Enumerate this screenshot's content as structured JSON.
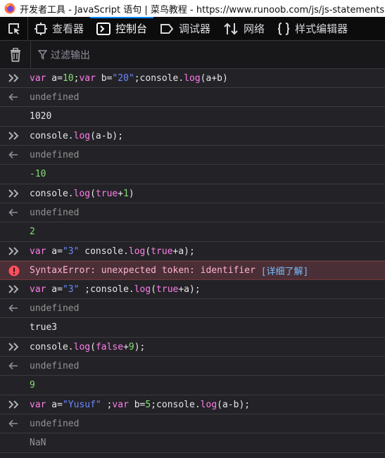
{
  "titlebar": {
    "text": "开发者工具 - JavaScript 语句 | 菜鸟教程 - https://www.runoob.com/js/js-statements.html"
  },
  "toolbar": {
    "tabs": [
      {
        "label": "查看器",
        "icon": "inspector-icon"
      },
      {
        "label": "控制台",
        "icon": "console-icon"
      },
      {
        "label": "调试器",
        "icon": "debugger-icon"
      },
      {
        "label": "网络",
        "icon": "network-icon"
      },
      {
        "label": "样式编辑器",
        "icon": "style-editor-icon"
      }
    ]
  },
  "filter": {
    "placeholder": "过滤输出"
  },
  "console": {
    "entries": [
      {
        "type": "input",
        "tokens": [
          [
            "kw",
            "var"
          ],
          [
            "id",
            " a="
          ],
          [
            "nm",
            "10"
          ],
          [
            "id",
            ";"
          ],
          [
            "kw",
            "var"
          ],
          [
            "id",
            " b="
          ],
          [
            "str",
            "\"20\""
          ],
          [
            "id",
            ";console."
          ],
          [
            "fn",
            "log"
          ],
          [
            "id",
            "(a+b)"
          ]
        ]
      },
      {
        "type": "result",
        "text": "undefined"
      },
      {
        "type": "log",
        "text": "1020",
        "cls": "plain"
      },
      {
        "type": "input",
        "tokens": [
          [
            "id",
            "console."
          ],
          [
            "fn",
            "log"
          ],
          [
            "id",
            "(a-b);"
          ]
        ]
      },
      {
        "type": "result",
        "text": "undefined"
      },
      {
        "type": "log",
        "text": "-10",
        "cls": "num"
      },
      {
        "type": "input",
        "tokens": [
          [
            "id",
            "console."
          ],
          [
            "fn",
            "log"
          ],
          [
            "id",
            "("
          ],
          [
            "kw",
            "true"
          ],
          [
            "id",
            "+"
          ],
          [
            "nm",
            "1"
          ],
          [
            "id",
            ")"
          ]
        ]
      },
      {
        "type": "result",
        "text": "undefined"
      },
      {
        "type": "log",
        "text": "2",
        "cls": "num"
      },
      {
        "type": "input",
        "tokens": [
          [
            "kw",
            "var"
          ],
          [
            "id",
            " a="
          ],
          [
            "str",
            "\"3\""
          ],
          [
            "id",
            " console."
          ],
          [
            "fn",
            "log"
          ],
          [
            "id",
            "("
          ],
          [
            "kw",
            "true"
          ],
          [
            "id",
            "+a);"
          ]
        ]
      },
      {
        "type": "error",
        "text": "SyntaxError: unexpected token: identifier ",
        "link": "[详细了解]"
      },
      {
        "type": "input",
        "tokens": [
          [
            "kw",
            "var"
          ],
          [
            "id",
            " a="
          ],
          [
            "str",
            "\"3\""
          ],
          [
            "id",
            " ;console."
          ],
          [
            "fn",
            "log"
          ],
          [
            "id",
            "("
          ],
          [
            "kw",
            "true"
          ],
          [
            "id",
            "+a);"
          ]
        ]
      },
      {
        "type": "result",
        "text": "undefined"
      },
      {
        "type": "log",
        "text": "true3",
        "cls": "plain"
      },
      {
        "type": "input",
        "tokens": [
          [
            "id",
            "console."
          ],
          [
            "fn",
            "log"
          ],
          [
            "id",
            "("
          ],
          [
            "kw",
            "false"
          ],
          [
            "id",
            "+"
          ],
          [
            "nm",
            "9"
          ],
          [
            "id",
            ");"
          ]
        ]
      },
      {
        "type": "result",
        "text": "undefined"
      },
      {
        "type": "log",
        "text": "9",
        "cls": "num"
      },
      {
        "type": "input",
        "tokens": [
          [
            "kw",
            "var"
          ],
          [
            "id",
            " a="
          ],
          [
            "str",
            "\"Yusuf\""
          ],
          [
            "id",
            " ;"
          ],
          [
            "kw",
            "var"
          ],
          [
            "id",
            " b="
          ],
          [
            "nm",
            "5"
          ],
          [
            "id",
            ";console."
          ],
          [
            "fn",
            "log"
          ],
          [
            "id",
            "(a-b);"
          ]
        ]
      },
      {
        "type": "result",
        "text": "undefined"
      },
      {
        "type": "log",
        "text": "NaN",
        "cls": "nan"
      }
    ]
  }
}
